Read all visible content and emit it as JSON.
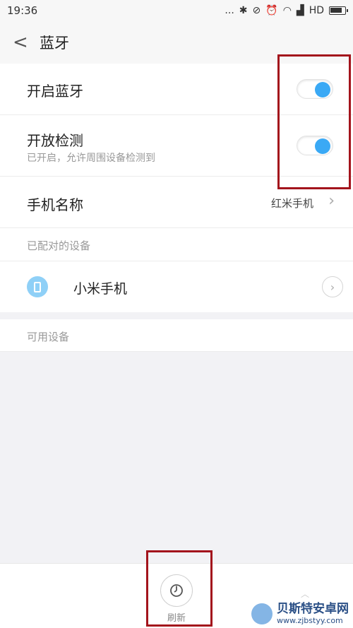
{
  "status_bar": {
    "time": "19:36",
    "dots": "...",
    "network": "HD"
  },
  "header": {
    "back_glyph": "<",
    "title": "蓝牙"
  },
  "settings": {
    "bluetooth": {
      "label": "开启蓝牙",
      "enabled": true
    },
    "discoverable": {
      "label": "开放检测",
      "sub": "已开启，允许周围设备检测到",
      "enabled": true
    },
    "device_name": {
      "label": "手机名称",
      "value": "红米手机"
    }
  },
  "paired": {
    "section_label": "已配对的设备",
    "devices": [
      {
        "name": "小米手机",
        "icon": "phone-icon"
      }
    ]
  },
  "available": {
    "section_label": "可用设备"
  },
  "bottom": {
    "refresh_label": "刷新"
  },
  "watermark": {
    "title": "贝斯特安卓网",
    "url": "www.zjbstyy.com"
  },
  "colors": {
    "accent": "#3aa9f5",
    "highlight": "#a3141c"
  }
}
